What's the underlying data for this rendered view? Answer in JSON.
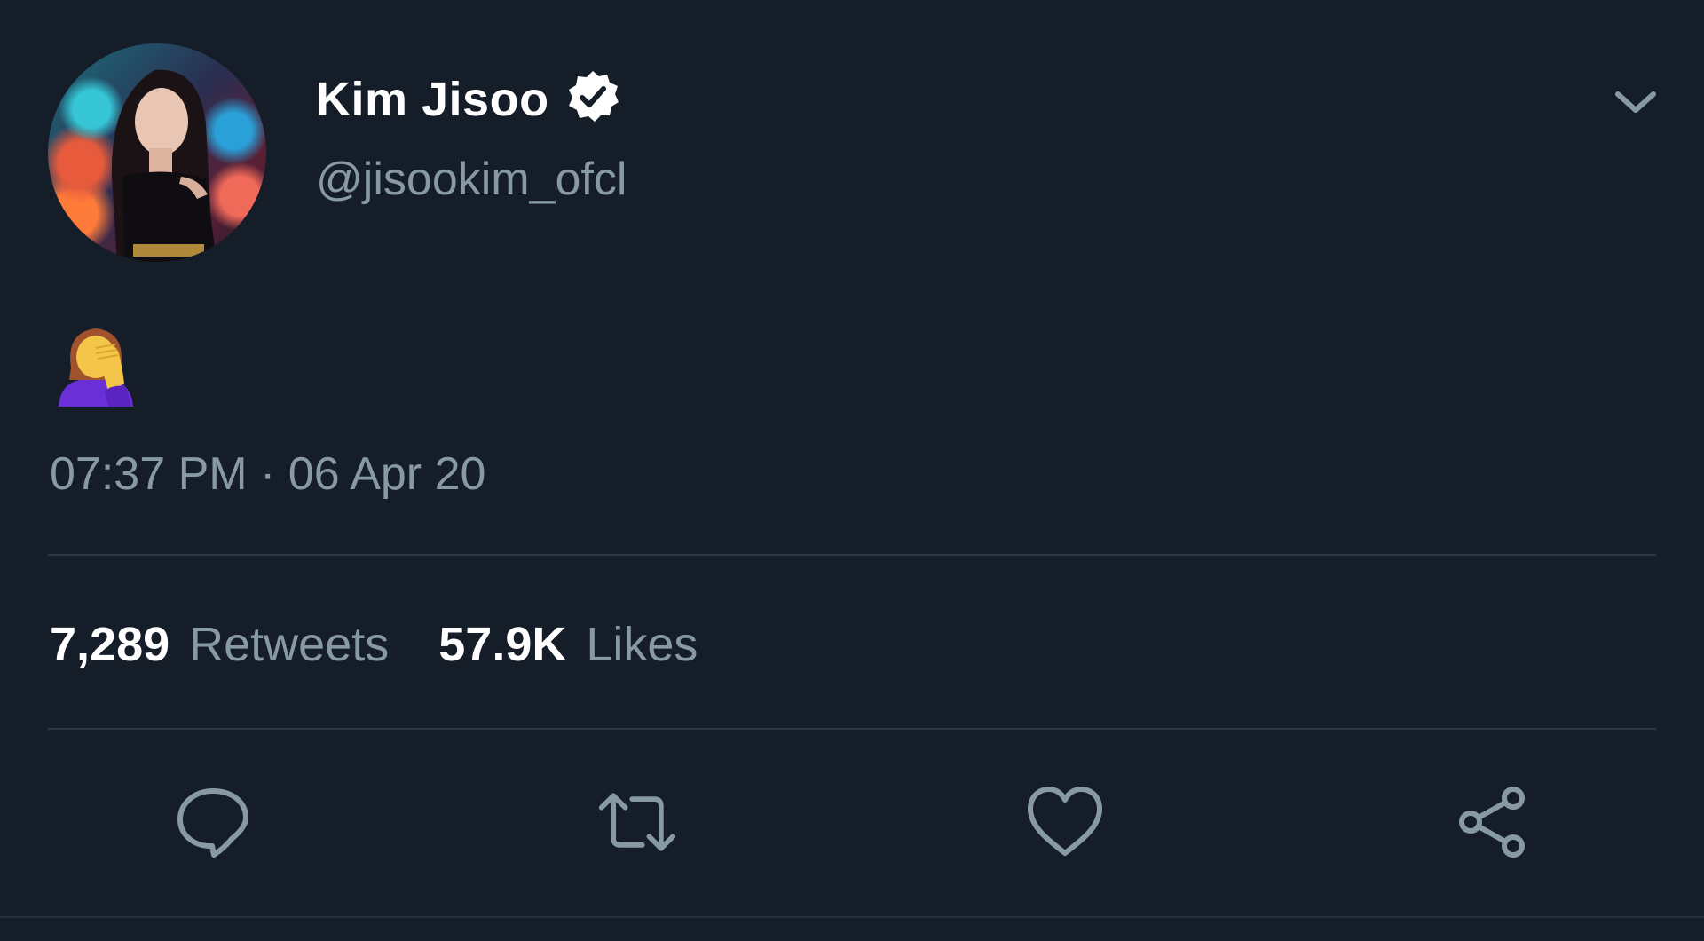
{
  "tweet": {
    "author": {
      "display_name": "Kim Jisoo",
      "handle": "@jisookim_ofcl",
      "verified": true,
      "verified_icon": "verified-badge-icon"
    },
    "content_emoji": "🤦‍♀️",
    "timestamp": "07:37 PM · 06 Apr 20",
    "stats": {
      "retweets_count": "7,289",
      "retweets_label": "Retweets",
      "likes_count": "57.9K",
      "likes_label": "Likes"
    },
    "actions": [
      {
        "icon": "reply-icon"
      },
      {
        "icon": "retweet-icon"
      },
      {
        "icon": "like-heart-icon"
      },
      {
        "icon": "share-icon"
      }
    ],
    "menu_icon": "chevron-down-icon"
  },
  "colors": {
    "background": "#151d29",
    "primary_text": "#ffffff",
    "secondary_text": "#8899a6",
    "divider": "#2c3743"
  }
}
